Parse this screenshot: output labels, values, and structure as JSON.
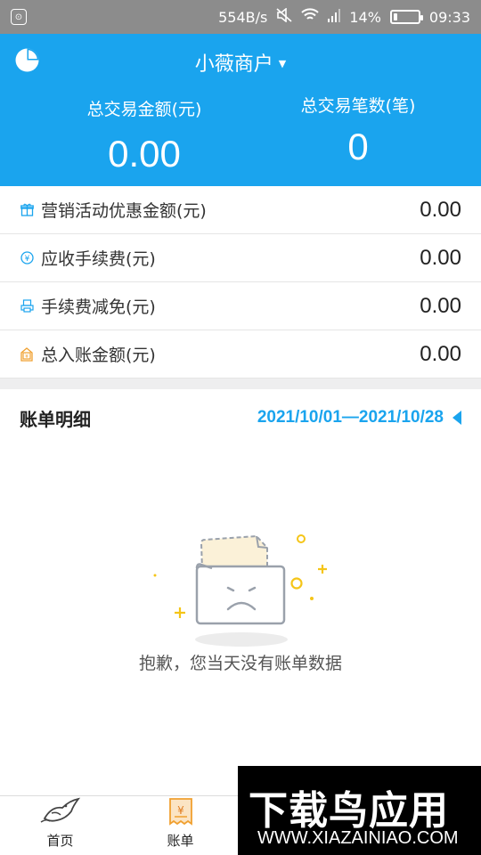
{
  "status_bar": {
    "speed": "554B/s",
    "battery": "14%",
    "battery_level": 0.14,
    "time": "09:33"
  },
  "header": {
    "merchant_name": "小薇商户",
    "total_amount_label": "总交易金额(元)",
    "total_amount_value": "0.00",
    "total_count_label": "总交易笔数(笔)",
    "total_count_value": "0"
  },
  "details": [
    {
      "label": "营销活动优惠金额(元)",
      "value": "0.00",
      "icon": "gift-icon",
      "color": "#1aa4ee"
    },
    {
      "label": "应收手续费(元)",
      "value": "0.00",
      "icon": "yen-coin-icon",
      "color": "#1aa4ee"
    },
    {
      "label": "手续费减免(元)",
      "value": "0.00",
      "icon": "printer-icon",
      "color": "#1aa4ee"
    },
    {
      "label": "总入账金额(元)",
      "value": "0.00",
      "icon": "wallet-yen-icon",
      "color": "#f0a030"
    }
  ],
  "bill": {
    "title": "账单明细",
    "date_range": "2021/10/01—2021/10/28",
    "empty_message": "抱歉，您当天没有账单数据"
  },
  "bottom_nav": [
    {
      "label": "首页",
      "icon": "bird-logo-icon"
    },
    {
      "label": "账单",
      "icon": "receipt-yen-icon"
    }
  ],
  "watermark": {
    "brand": "下载鸟应用",
    "url": "WWW.XIAZAINIAO.COM"
  },
  "colors": {
    "primary": "#1aa4ee",
    "accent_orange": "#f0a030",
    "empty_yellow": "#f5c518"
  }
}
